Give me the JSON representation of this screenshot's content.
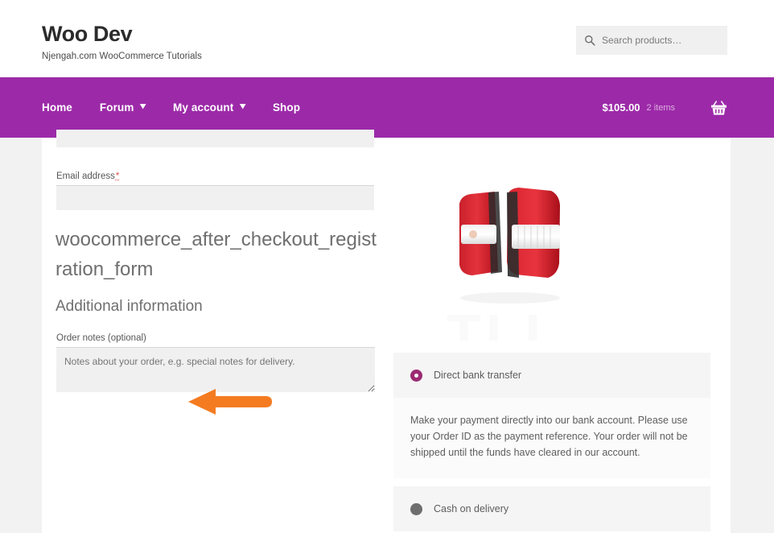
{
  "site": {
    "title": "Woo Dev",
    "tagline": "Njengah.com WooCommerce Tutorials"
  },
  "search": {
    "placeholder": "Search products…",
    "icon": "search-icon"
  },
  "nav": {
    "items": [
      {
        "label": "Home",
        "has_dropdown": false
      },
      {
        "label": "Forum",
        "has_dropdown": true
      },
      {
        "label": "My account",
        "has_dropdown": true
      },
      {
        "label": "Shop",
        "has_dropdown": false
      }
    ],
    "caret_glyph": "❯",
    "background_color": "#9c2aa8"
  },
  "cart": {
    "amount": "$105.00",
    "item_count": "2 items",
    "icon": "shopping-basket-icon"
  },
  "checkout": {
    "email": {
      "label": "Email address",
      "required_marker": "*",
      "value": "",
      "placeholder": ""
    },
    "hook_name": "woocommerce_after_checkout_registration_form",
    "annotation": {
      "type": "arrow-left",
      "color": "#F47B20"
    },
    "additional_information": {
      "heading": "Additional information",
      "order_notes_label": "Order notes (optional)",
      "order_notes_value": "",
      "order_notes_placeholder": "Notes about your order, e.g. special notes for delivery."
    }
  },
  "order_review": {
    "product_image_alt": "Pair of red and clear automotive tail lights",
    "watermark": "TLL",
    "payment_methods": [
      {
        "label": "Direct bank transfer",
        "selected": true,
        "description": "Make your payment directly into our bank account. Please use your Order ID as the payment reference. Your order will not be shipped until the funds have cleared in our account."
      },
      {
        "label": "Cash on delivery",
        "selected": false,
        "description": ""
      }
    ]
  },
  "colors": {
    "brand_purple": "#9c2aa8",
    "radio_selected": "#9c2a72",
    "radio_unselected": "#6e6e6e",
    "annotation_orange": "#F47B20",
    "field_background": "#f0f0f0",
    "page_background": "#f2f2f2"
  }
}
